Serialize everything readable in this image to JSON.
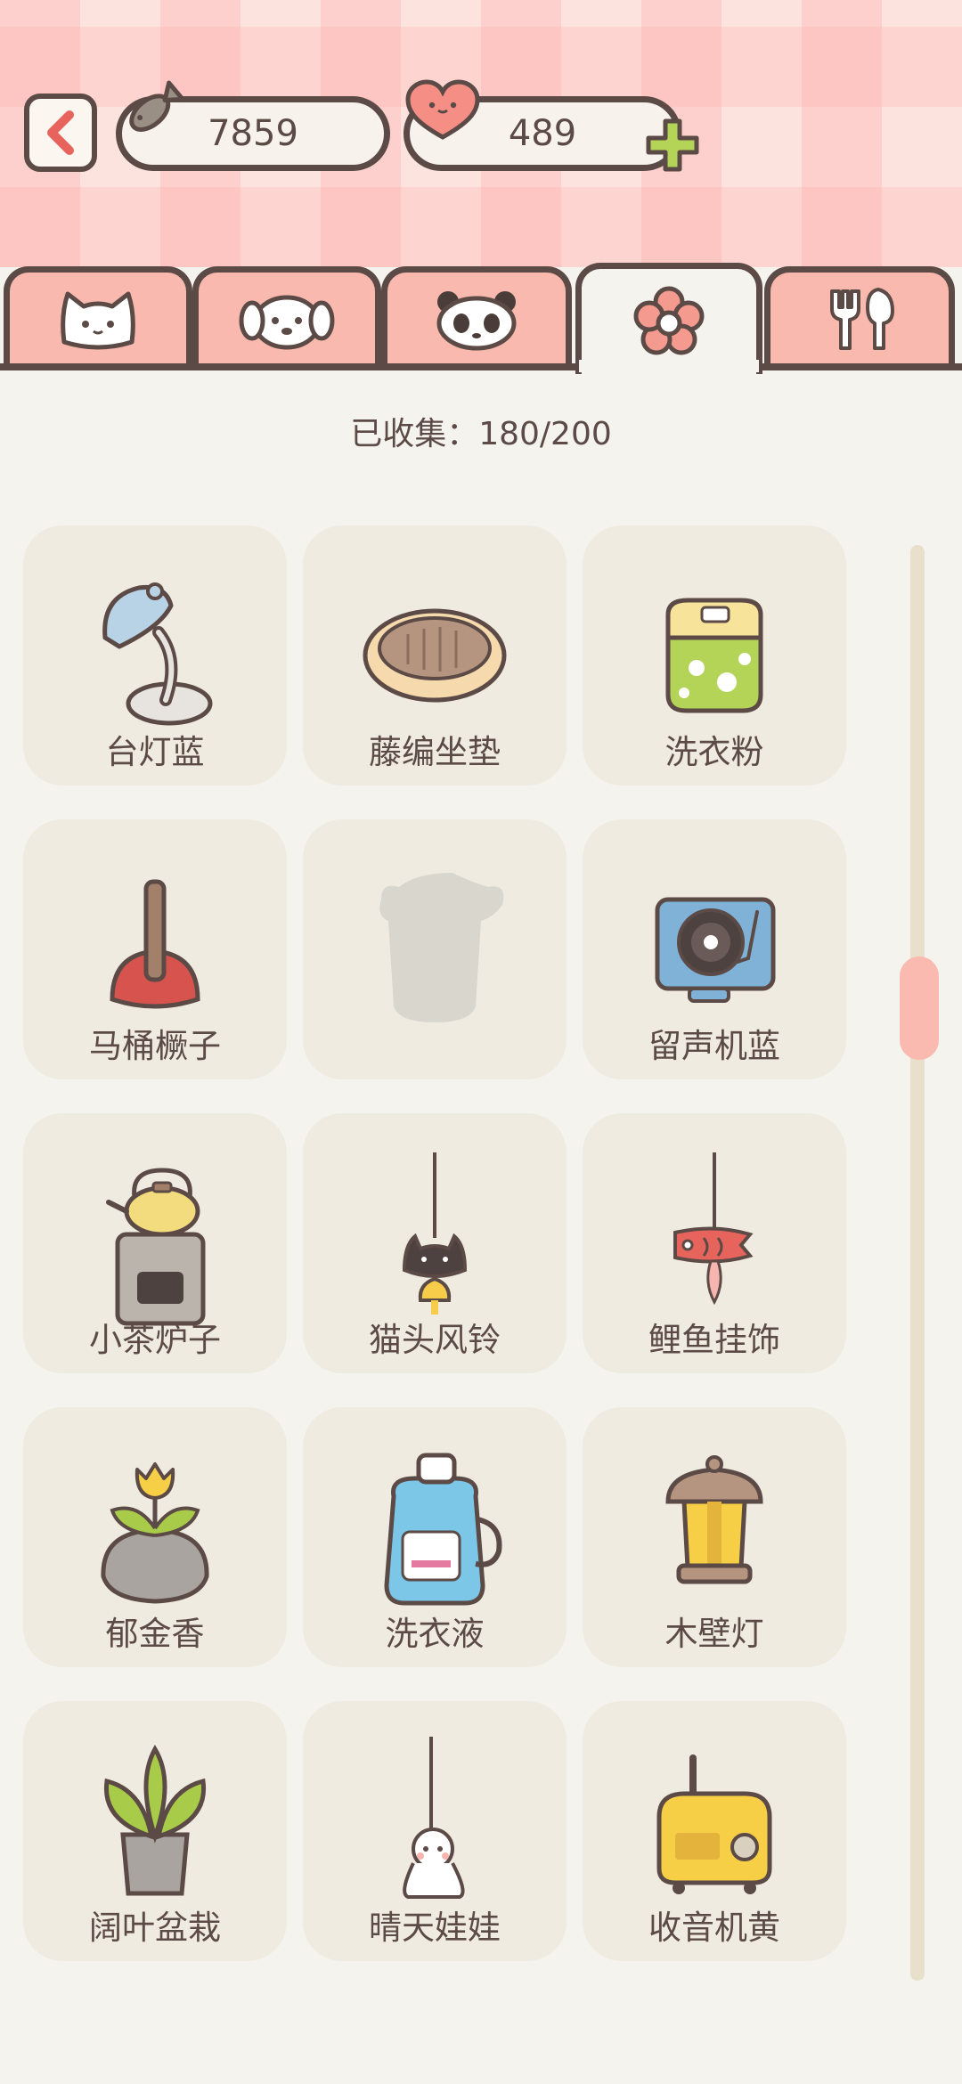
{
  "header": {
    "fish_count": "7859",
    "heart_count": "489"
  },
  "tabs": [
    {
      "icon": "cat-face-icon"
    },
    {
      "icon": "dog-face-icon"
    },
    {
      "icon": "panda-face-icon"
    },
    {
      "icon": "flower-icon",
      "active": true
    },
    {
      "icon": "fork-spoon-icon"
    }
  ],
  "collected_text": "已收集：180/200",
  "items": [
    {
      "label": "台灯蓝",
      "icon": "desk-lamp-icon"
    },
    {
      "label": "藤编坐垫",
      "icon": "rattan-cushion-icon"
    },
    {
      "label": "洗衣粉",
      "icon": "detergent-powder-icon"
    },
    {
      "label": "马桶橛子",
      "icon": "plunger-icon"
    },
    {
      "label": "",
      "icon": "locked-silhouette-icon"
    },
    {
      "label": "留声机蓝",
      "icon": "record-player-icon"
    },
    {
      "label": "小茶炉子",
      "icon": "tea-stove-icon"
    },
    {
      "label": "猫头风铃",
      "icon": "cat-wind-chime-icon"
    },
    {
      "label": "鲤鱼挂饰",
      "icon": "carp-ornament-icon"
    },
    {
      "label": "郁金香",
      "icon": "tulip-icon"
    },
    {
      "label": "洗衣液",
      "icon": "laundry-liquid-icon"
    },
    {
      "label": "木壁灯",
      "icon": "wall-lamp-icon"
    },
    {
      "label": "阔叶盆栽",
      "icon": "potted-plant-icon"
    },
    {
      "label": "晴天娃娃",
      "icon": "teru-teru-bozu-icon"
    },
    {
      "label": "收音机黄",
      "icon": "radio-icon"
    }
  ],
  "colors": {
    "outline": "#5b4a45",
    "tab_inactive": "#f9b9ae",
    "card_bg": "#efebe1",
    "accent_green": "#a8cc4a"
  }
}
